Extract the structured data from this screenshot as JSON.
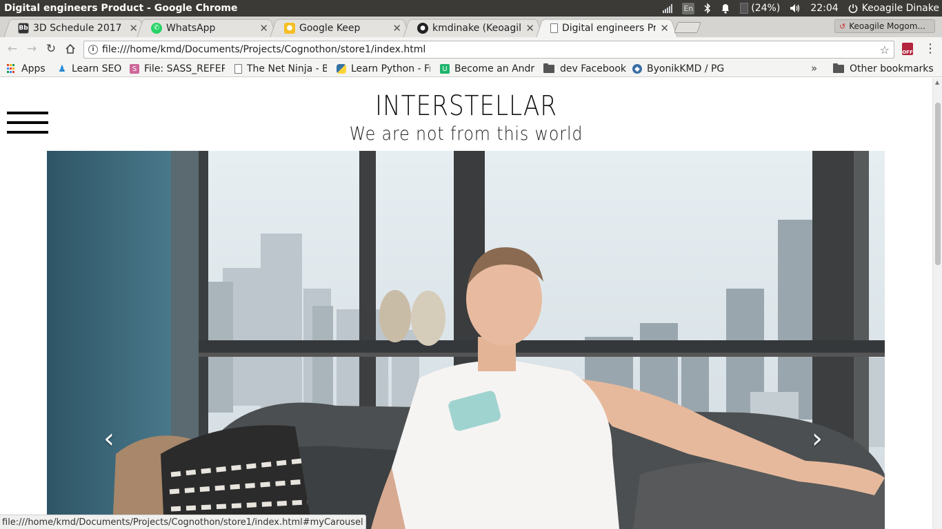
{
  "window": {
    "title": "Digital engineers Product - Google Chrome"
  },
  "tray": {
    "keyboard": "En",
    "battery": "(24%)",
    "time": "22:04",
    "user": "Keoagile Dinake"
  },
  "tabs": [
    {
      "label": "3D Schedule 2017 –",
      "favicon": "Bb"
    },
    {
      "label": "WhatsApp",
      "favicon": "whatsapp-icon"
    },
    {
      "label": "Google Keep",
      "favicon": "keep-icon"
    },
    {
      "label": "kmdinake (Keoagile",
      "favicon": "github-icon"
    },
    {
      "label": "Digital engineers Pr",
      "favicon": "page-icon"
    }
  ],
  "profile": {
    "label": "Keoagile Mogom..."
  },
  "omnibox": {
    "url": "file:///home/kmd/Documents/Projects/Cognothon/store1/index.html"
  },
  "extension": {
    "badge": "OFF"
  },
  "bookmarks": [
    {
      "label": "Apps"
    },
    {
      "label": "Learn SEO"
    },
    {
      "label": "File: SASS_REFER"
    },
    {
      "label": "The Net Ninja - B"
    },
    {
      "label": "Learn Python - Fr"
    },
    {
      "label": "Become an Andr"
    },
    {
      "label": "dev Facebook"
    },
    {
      "label": "ByonikKMD / PG"
    }
  ],
  "bookmarks_overflow": "»",
  "other_bookmarks": "Other bookmarks",
  "page": {
    "title": "INTERSTELLAR",
    "subtitle": "We are not from this world",
    "carousel_prev": "‹",
    "carousel_next": "›"
  },
  "status_url": "file:///home/kmd/Documents/Projects/Cognothon/store1/index.html#myCarousel",
  "colors": {
    "os_panel": "#3b3a36",
    "tabstrip": "#d6d4d0",
    "toolbar": "#f4f4f3"
  }
}
